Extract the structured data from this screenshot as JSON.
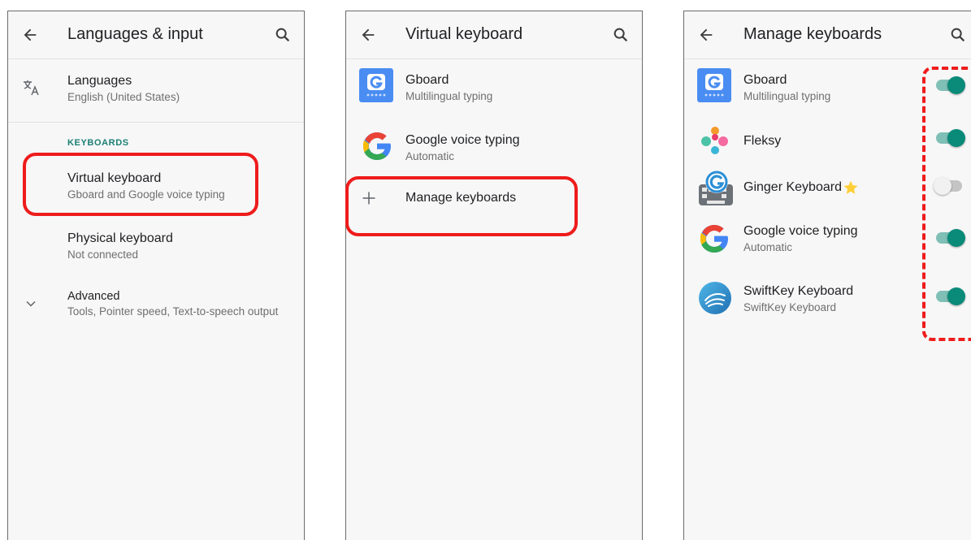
{
  "screen1": {
    "title": "Languages & input",
    "languages": {
      "title": "Languages",
      "subtitle": "English (United States)"
    },
    "section_label": "KEYBOARDS",
    "virtual_keyboard": {
      "title": "Virtual keyboard",
      "subtitle": "Gboard and Google voice typing"
    },
    "physical_keyboard": {
      "title": "Physical keyboard",
      "subtitle": "Not connected"
    },
    "advanced": {
      "title": "Advanced",
      "subtitle": "Tools, Pointer speed, Text-to-speech output"
    }
  },
  "screen2": {
    "title": "Virtual keyboard",
    "gboard": {
      "title": "Gboard",
      "subtitle": "Multilingual typing"
    },
    "voice": {
      "title": "Google voice typing",
      "subtitle": "Automatic"
    },
    "manage": {
      "title": "Manage keyboards"
    }
  },
  "screen3": {
    "title": "Manage keyboards",
    "keyboards": [
      {
        "name": "Gboard",
        "subtitle": "Multilingual typing",
        "enabled": true
      },
      {
        "name": "Fleksy",
        "subtitle": "",
        "enabled": true
      },
      {
        "name": "Ginger Keyboard",
        "subtitle": "",
        "enabled": false
      },
      {
        "name": "Google voice typing",
        "subtitle": "Automatic",
        "enabled": true
      },
      {
        "name": "SwiftKey Keyboard",
        "subtitle": "SwiftKey Keyboard",
        "enabled": true
      }
    ]
  },
  "icons": [
    "back-arrow-icon",
    "search-icon",
    "translate-icon",
    "chevron-down-icon",
    "plus-icon",
    "gboard-icon",
    "google-g-icon",
    "fleksy-icon",
    "ginger-icon",
    "star-icon",
    "swiftkey-icon"
  ],
  "colors": {
    "accent": "#0a8a79",
    "highlight": "#ee1c1c",
    "section": "#1a7f74"
  }
}
